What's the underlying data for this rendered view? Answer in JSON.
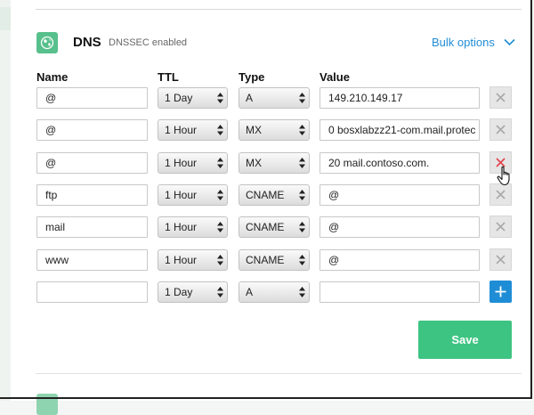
{
  "section": {
    "title": "DNS",
    "status": "DNSSEC enabled",
    "bulk_options_label": "Bulk options"
  },
  "columns": {
    "name": "Name",
    "ttl": "TTL",
    "type": "Type",
    "value": "Value"
  },
  "records": [
    {
      "name": "@",
      "ttl": "1 Day",
      "type": "A",
      "value": "149.210.149.17"
    },
    {
      "name": "@",
      "ttl": "1 Hour",
      "type": "MX",
      "value": "0 bosxlabzz21-com.mail.protec"
    },
    {
      "name": "@",
      "ttl": "1 Hour",
      "type": "MX",
      "value": "20 mail.contoso.com."
    },
    {
      "name": "ftp",
      "ttl": "1 Hour",
      "type": "CNAME",
      "value": "@"
    },
    {
      "name": "mail",
      "ttl": "1 Hour",
      "type": "CNAME",
      "value": "@"
    },
    {
      "name": "www",
      "ttl": "1 Hour",
      "type": "CNAME",
      "value": "@"
    }
  ],
  "new_record": {
    "name": "",
    "ttl": "1 Day",
    "type": "A",
    "value": ""
  },
  "save_label": "Save",
  "colors": {
    "accent_blue": "#1f8dd6",
    "save_green": "#3ec482",
    "icon_green": "#57c08c",
    "delete_hover_red": "#e0434b"
  }
}
